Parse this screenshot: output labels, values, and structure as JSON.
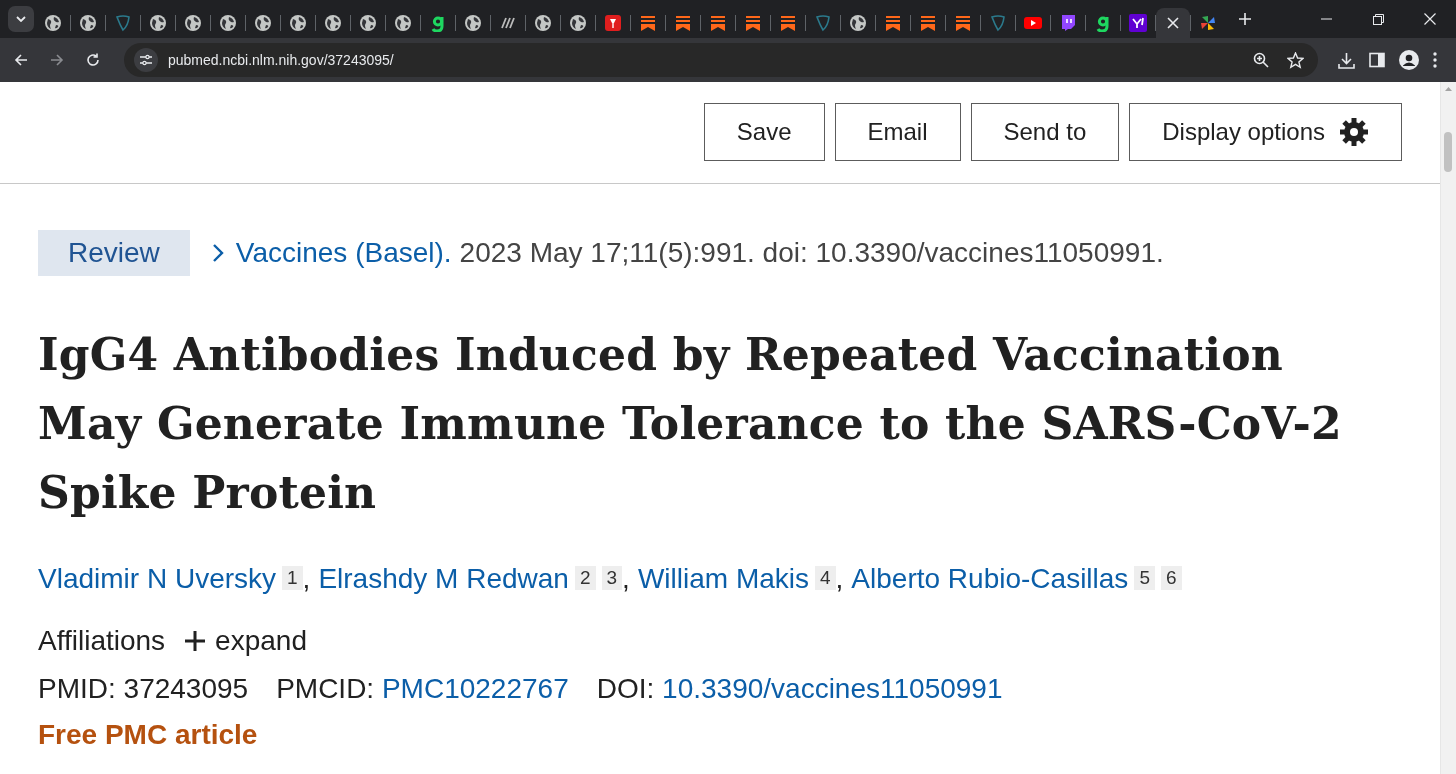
{
  "browser": {
    "tabs": [
      {
        "kind": "globe",
        "selected": false
      },
      {
        "kind": "globe",
        "selected": false
      },
      {
        "kind": "shield",
        "selected": false
      },
      {
        "kind": "globe",
        "selected": false
      },
      {
        "kind": "globe",
        "selected": false
      },
      {
        "kind": "globe",
        "selected": false
      },
      {
        "kind": "globe",
        "selected": false
      },
      {
        "kind": "globe",
        "selected": false
      },
      {
        "kind": "globe",
        "selected": false
      },
      {
        "kind": "globe",
        "selected": false
      },
      {
        "kind": "globe",
        "selected": false
      },
      {
        "kind": "g",
        "selected": false
      },
      {
        "kind": "globe",
        "selected": false
      },
      {
        "kind": "slash",
        "selected": false
      },
      {
        "kind": "globe",
        "selected": false
      },
      {
        "kind": "globe",
        "selected": false
      },
      {
        "kind": "red",
        "selected": false
      },
      {
        "kind": "bookmark",
        "selected": false
      },
      {
        "kind": "bookmark",
        "selected": false
      },
      {
        "kind": "bookmark",
        "selected": false
      },
      {
        "kind": "bookmark",
        "selected": false
      },
      {
        "kind": "bookmark",
        "selected": false
      },
      {
        "kind": "shield",
        "selected": false
      },
      {
        "kind": "globe",
        "selected": false
      },
      {
        "kind": "bookmark",
        "selected": false
      },
      {
        "kind": "bookmark",
        "selected": false
      },
      {
        "kind": "bookmark",
        "selected": false
      },
      {
        "kind": "shield",
        "selected": false
      },
      {
        "kind": "youtube",
        "selected": false
      },
      {
        "kind": "twitch",
        "selected": false
      },
      {
        "kind": "g",
        "selected": false
      },
      {
        "kind": "yahoo",
        "selected": false
      },
      {
        "kind": "close",
        "selected": true
      },
      {
        "kind": "pinwheel",
        "selected": false
      }
    ],
    "url": "pubmed.ncbi.nlm.nih.gov/37243095/"
  },
  "actions": [
    {
      "label": "Save",
      "kind": "plain"
    },
    {
      "label": "Email",
      "kind": "plain"
    },
    {
      "label": "Send to",
      "kind": "plain"
    },
    {
      "label": "Display options",
      "kind": "settings"
    }
  ],
  "article": {
    "publication_type": "Review",
    "journal": "Vaccines (Basel).",
    "citation": "2023 May 17;11(5):991. doi: 10.3390/vaccines11050991.",
    "title": "IgG4 Antibodies Induced by Repeated Vaccination May Generate Immune Tolerance to the SARS-CoV-2 Spike Protein",
    "authors": [
      {
        "name": "Vladimir N Uversky",
        "affiliations": [
          "1"
        ],
        "separator": ","
      },
      {
        "name": "Elrashdy M Redwan",
        "affiliations": [
          "2",
          "3"
        ],
        "separator": ","
      },
      {
        "name": "William Makis",
        "affiliations": [
          "4"
        ],
        "separator": ","
      },
      {
        "name": "Alberto Rubio-Casillas",
        "affiliations": [
          "5",
          "6"
        ]
      }
    ],
    "affiliations_label": "Affiliations",
    "expand_label": "expand",
    "identifiers": [
      {
        "label": "PMID:",
        "value": "37243095",
        "link": false
      },
      {
        "label": "PMCID:",
        "value": "PMC10222767",
        "link": true
      },
      {
        "label": "DOI:",
        "value": "10.3390/vaccines11050991",
        "link": true
      }
    ],
    "free_article": "Free PMC article"
  }
}
